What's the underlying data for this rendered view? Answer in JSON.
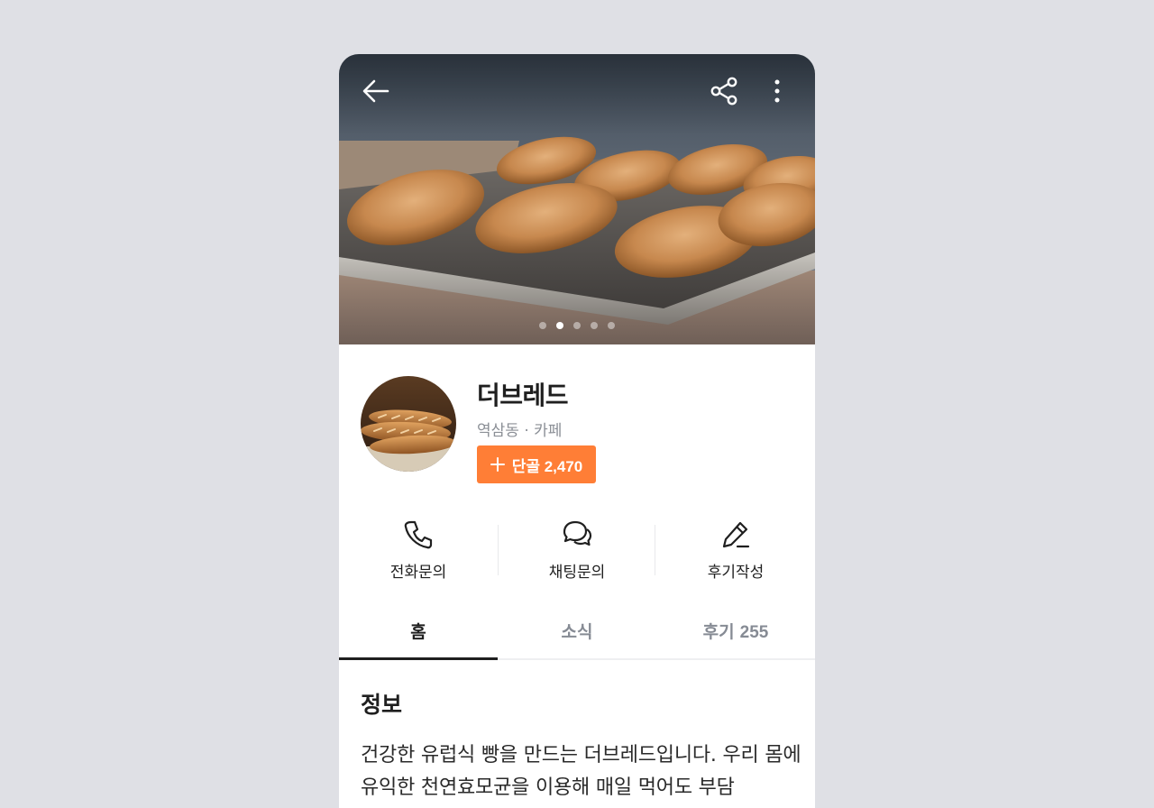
{
  "hero": {
    "image": "croissants-on-baking-tray",
    "page_indicator": {
      "count": 5,
      "active_index": 1
    },
    "icons": {
      "back": "back-arrow-icon",
      "share": "share-icon",
      "more": "more-vertical-icon"
    }
  },
  "profile": {
    "avatar": "baguette-avatar",
    "name": "더브레드",
    "meta": "역삼동 · 카페",
    "regular_button": {
      "icon": "plus-icon",
      "label": "단골 2,470"
    }
  },
  "actions": [
    {
      "icon": "phone-icon",
      "label": "전화문의"
    },
    {
      "icon": "chat-icon",
      "label": "채팅문의"
    },
    {
      "icon": "pencil-icon",
      "label": "후기작성"
    }
  ],
  "tabs": [
    {
      "label": "홈",
      "count": "",
      "active": true
    },
    {
      "label": "소식",
      "count": "",
      "active": false
    },
    {
      "label": "후기",
      "count": "255",
      "active": false
    }
  ],
  "info": {
    "title": "정보",
    "description": "건강한 유럽식 빵을 만드는 더브레드입니다. 우리 몸에 유익한 천연효모균을 이용해 매일 먹어도 부담"
  },
  "colors": {
    "accent": "#ff7e36",
    "background": "#dfe0e5",
    "text_primary": "#1f1f1f",
    "text_secondary": "#868b94"
  }
}
